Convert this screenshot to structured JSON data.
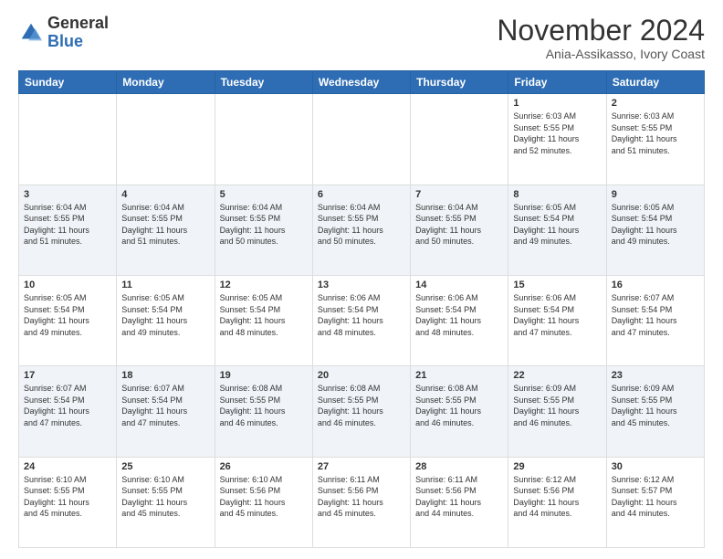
{
  "logo": {
    "general": "General",
    "blue": "Blue"
  },
  "header": {
    "month": "November 2024",
    "location": "Ania-Assikasso, Ivory Coast"
  },
  "days_of_week": [
    "Sunday",
    "Monday",
    "Tuesday",
    "Wednesday",
    "Thursday",
    "Friday",
    "Saturday"
  ],
  "weeks": [
    [
      {
        "day": "",
        "info": ""
      },
      {
        "day": "",
        "info": ""
      },
      {
        "day": "",
        "info": ""
      },
      {
        "day": "",
        "info": ""
      },
      {
        "day": "",
        "info": ""
      },
      {
        "day": "1",
        "info": "Sunrise: 6:03 AM\nSunset: 5:55 PM\nDaylight: 11 hours\nand 52 minutes."
      },
      {
        "day": "2",
        "info": "Sunrise: 6:03 AM\nSunset: 5:55 PM\nDaylight: 11 hours\nand 51 minutes."
      }
    ],
    [
      {
        "day": "3",
        "info": "Sunrise: 6:04 AM\nSunset: 5:55 PM\nDaylight: 11 hours\nand 51 minutes."
      },
      {
        "day": "4",
        "info": "Sunrise: 6:04 AM\nSunset: 5:55 PM\nDaylight: 11 hours\nand 51 minutes."
      },
      {
        "day": "5",
        "info": "Sunrise: 6:04 AM\nSunset: 5:55 PM\nDaylight: 11 hours\nand 50 minutes."
      },
      {
        "day": "6",
        "info": "Sunrise: 6:04 AM\nSunset: 5:55 PM\nDaylight: 11 hours\nand 50 minutes."
      },
      {
        "day": "7",
        "info": "Sunrise: 6:04 AM\nSunset: 5:55 PM\nDaylight: 11 hours\nand 50 minutes."
      },
      {
        "day": "8",
        "info": "Sunrise: 6:05 AM\nSunset: 5:54 PM\nDaylight: 11 hours\nand 49 minutes."
      },
      {
        "day": "9",
        "info": "Sunrise: 6:05 AM\nSunset: 5:54 PM\nDaylight: 11 hours\nand 49 minutes."
      }
    ],
    [
      {
        "day": "10",
        "info": "Sunrise: 6:05 AM\nSunset: 5:54 PM\nDaylight: 11 hours\nand 49 minutes."
      },
      {
        "day": "11",
        "info": "Sunrise: 6:05 AM\nSunset: 5:54 PM\nDaylight: 11 hours\nand 49 minutes."
      },
      {
        "day": "12",
        "info": "Sunrise: 6:05 AM\nSunset: 5:54 PM\nDaylight: 11 hours\nand 48 minutes."
      },
      {
        "day": "13",
        "info": "Sunrise: 6:06 AM\nSunset: 5:54 PM\nDaylight: 11 hours\nand 48 minutes."
      },
      {
        "day": "14",
        "info": "Sunrise: 6:06 AM\nSunset: 5:54 PM\nDaylight: 11 hours\nand 48 minutes."
      },
      {
        "day": "15",
        "info": "Sunrise: 6:06 AM\nSunset: 5:54 PM\nDaylight: 11 hours\nand 47 minutes."
      },
      {
        "day": "16",
        "info": "Sunrise: 6:07 AM\nSunset: 5:54 PM\nDaylight: 11 hours\nand 47 minutes."
      }
    ],
    [
      {
        "day": "17",
        "info": "Sunrise: 6:07 AM\nSunset: 5:54 PM\nDaylight: 11 hours\nand 47 minutes."
      },
      {
        "day": "18",
        "info": "Sunrise: 6:07 AM\nSunset: 5:54 PM\nDaylight: 11 hours\nand 47 minutes."
      },
      {
        "day": "19",
        "info": "Sunrise: 6:08 AM\nSunset: 5:55 PM\nDaylight: 11 hours\nand 46 minutes."
      },
      {
        "day": "20",
        "info": "Sunrise: 6:08 AM\nSunset: 5:55 PM\nDaylight: 11 hours\nand 46 minutes."
      },
      {
        "day": "21",
        "info": "Sunrise: 6:08 AM\nSunset: 5:55 PM\nDaylight: 11 hours\nand 46 minutes."
      },
      {
        "day": "22",
        "info": "Sunrise: 6:09 AM\nSunset: 5:55 PM\nDaylight: 11 hours\nand 46 minutes."
      },
      {
        "day": "23",
        "info": "Sunrise: 6:09 AM\nSunset: 5:55 PM\nDaylight: 11 hours\nand 45 minutes."
      }
    ],
    [
      {
        "day": "24",
        "info": "Sunrise: 6:10 AM\nSunset: 5:55 PM\nDaylight: 11 hours\nand 45 minutes."
      },
      {
        "day": "25",
        "info": "Sunrise: 6:10 AM\nSunset: 5:55 PM\nDaylight: 11 hours\nand 45 minutes."
      },
      {
        "day": "26",
        "info": "Sunrise: 6:10 AM\nSunset: 5:56 PM\nDaylight: 11 hours\nand 45 minutes."
      },
      {
        "day": "27",
        "info": "Sunrise: 6:11 AM\nSunset: 5:56 PM\nDaylight: 11 hours\nand 45 minutes."
      },
      {
        "day": "28",
        "info": "Sunrise: 6:11 AM\nSunset: 5:56 PM\nDaylight: 11 hours\nand 44 minutes."
      },
      {
        "day": "29",
        "info": "Sunrise: 6:12 AM\nSunset: 5:56 PM\nDaylight: 11 hours\nand 44 minutes."
      },
      {
        "day": "30",
        "info": "Sunrise: 6:12 AM\nSunset: 5:57 PM\nDaylight: 11 hours\nand 44 minutes."
      }
    ]
  ]
}
